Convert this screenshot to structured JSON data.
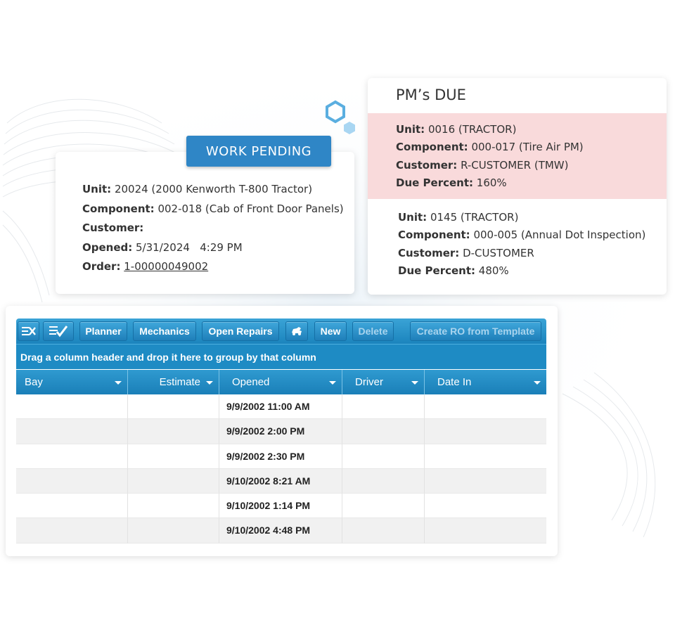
{
  "work_pending": {
    "badge": "WORK PENDING",
    "unit_label": "Unit:",
    "unit_value": " 20024 (2000 Kenworth T-800 Tractor)",
    "component_label": "Component:",
    "component_value": " 002-018 (Cab of Front Door Panels)",
    "customer_label": "Customer:",
    "customer_value": "",
    "opened_label": "Opened:",
    "opened_value": " 5/31/2024   4:29 PM",
    "order_label": "Order:",
    "order_value": "1-00000049002"
  },
  "pms_due": {
    "title": "PM’s DUE",
    "items": [
      {
        "unit_label": "Unit:",
        "unit_value": " 0016 (TRACTOR)",
        "component_label": "Component:",
        "component_value": " 000-017 (Tire Air PM)",
        "customer_label": "Customer:",
        "customer_value": " R-CUSTOMER (TMW)",
        "due_label": "Due Percent:",
        "due_value": " 160%",
        "highlight_color": "#f9dadb"
      },
      {
        "unit_label": "Unit:",
        "unit_value": " 0145 (TRACTOR)",
        "component_label": "Component:",
        "component_value": " 000-005 (Annual Dot Inspection)",
        "customer_label": "Customer:",
        "customer_value": " D-CUSTOMER",
        "due_label": "Due Percent:",
        "due_value": " 480%"
      }
    ]
  },
  "toolbar": {
    "buttons": [
      {
        "label": "Planner"
      },
      {
        "label": "Mechanics"
      },
      {
        "label": "Open Repairs"
      },
      {
        "label": "New"
      },
      {
        "label": "Delete",
        "disabled": true
      },
      {
        "label": "Create RO from Template",
        "disabled": true
      }
    ],
    "icons": [
      "clear-filter-icon",
      "edit-checklist-icon",
      "tow-truck-icon"
    ]
  },
  "grid": {
    "group_hint": "Drag a column header and drop it here to group by that column",
    "columns": [
      "Bay",
      "Estimate",
      "Opened",
      "Driver",
      "Date In"
    ],
    "rows": [
      {
        "bay": "",
        "estimate": "",
        "opened": "9/9/2002 11:00 AM",
        "driver": "",
        "date_in": ""
      },
      {
        "bay": "",
        "estimate": "",
        "opened": "9/9/2002 2:00 PM",
        "driver": "",
        "date_in": ""
      },
      {
        "bay": "",
        "estimate": "",
        "opened": "9/9/2002 2:30 PM",
        "driver": "",
        "date_in": ""
      },
      {
        "bay": "",
        "estimate": "",
        "opened": "9/10/2002 8:21 AM",
        "driver": "",
        "date_in": ""
      },
      {
        "bay": "",
        "estimate": "",
        "opened": "9/10/2002 1:14 PM",
        "driver": "",
        "date_in": ""
      },
      {
        "bay": "",
        "estimate": "",
        "opened": "9/10/2002 4:48 PM",
        "driver": "",
        "date_in": ""
      }
    ]
  },
  "colors": {
    "accent_blue": "#2f86c6",
    "toolbar_blue": "#1e8bc4",
    "pm_highlight": "#f9dadb"
  }
}
